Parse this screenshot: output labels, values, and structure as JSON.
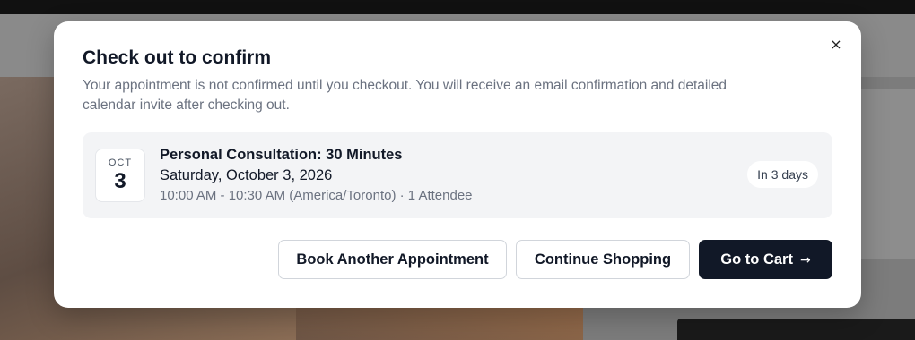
{
  "modal": {
    "title": "Check out to confirm",
    "description": "Your appointment is not confirmed until you checkout. You will receive an email confirmation and detailed calendar invite after checking out.",
    "close_icon": "×"
  },
  "appointment": {
    "month": "OCT",
    "day": "3",
    "title": "Personal Consultation: 30 Minutes",
    "date": "Saturday, October 3, 2026",
    "details": "10:00 AM - 10:30 AM (America/Toronto) · 1 Attendee",
    "badge": "In 3 days"
  },
  "actions": {
    "book_another": "Book Another Appointment",
    "continue_shopping": "Continue Shopping",
    "go_to_cart": "Go to Cart",
    "arrow_icon": "→"
  },
  "colors": {
    "primary": "#111827",
    "card_bg": "#f3f4f6",
    "muted_text": "#6b7280"
  }
}
